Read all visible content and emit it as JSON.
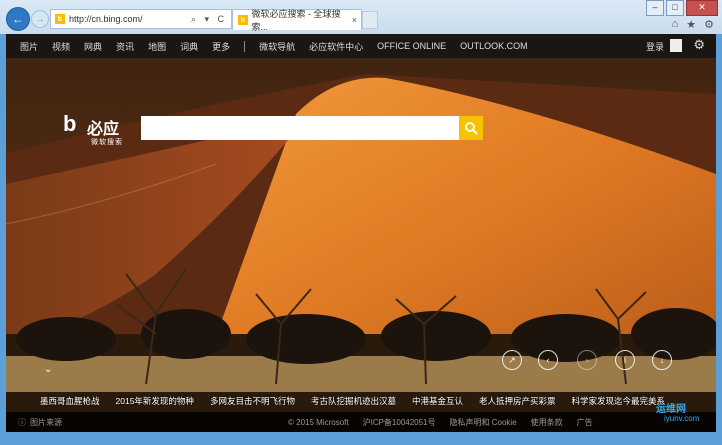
{
  "browser": {
    "address_url": "http://cn.bing.com/",
    "address_tools": "⌕ ▾ C",
    "tab_title": "微软必应搜索 - 全球搜索...",
    "tab_close": "×",
    "window_controls": {
      "minimize": "–",
      "maximize": "□",
      "close": "✕"
    }
  },
  "nav": {
    "items": [
      "图片",
      "视频",
      "网典",
      "资讯",
      "地图",
      "词典",
      "更多"
    ],
    "extra": [
      "微软导航",
      "必应软件中心",
      "OFFICE ONLINE",
      "OUTLOOK.COM"
    ],
    "login": "登录"
  },
  "logo": {
    "name": "必应",
    "sub": "微软搜索"
  },
  "search": {
    "value": "",
    "placeholder": ""
  },
  "news": [
    "墨西哥血腥枪战",
    "2015年新发现的物种",
    "多网友目击不明飞行物",
    "考古队挖掘机迹出汉墓",
    "中港基金互认",
    "老人抵押房产买彩票",
    "科学家发现迄今最完美系"
  ],
  "footer": {
    "image_source": "图片来源",
    "copyright": "© 2015 Microsoft",
    "icp": "沪ICP备10042051号",
    "privacy": "隐私声明和 Cookie",
    "terms": "使用条款",
    "ads": "广告"
  },
  "watermark": {
    "line1": "运维网",
    "line2": "iyunv.com"
  },
  "colors": {
    "accent": "#f7c200",
    "chrome": "#2f79c4",
    "navbar": "#1a1a1a"
  }
}
